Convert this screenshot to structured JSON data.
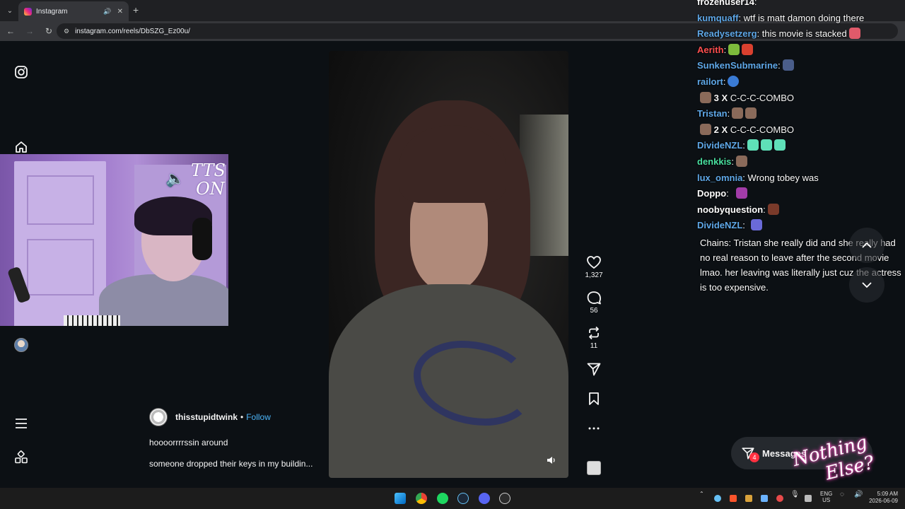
{
  "browser": {
    "tab_title": "Instagram",
    "new_tab": "+",
    "close": "✕",
    "url": "instagram.com/reels/DbSZG_Ez00u/"
  },
  "overlay": {
    "tts_line1": "TTS",
    "tts_line2": "ON"
  },
  "post": {
    "username": "thisstupidtwink",
    "separator": "•",
    "follow": "Follow",
    "caption_line1": "hoooorrrrssin around",
    "caption_line2": "someone dropped their keys in my buildin..."
  },
  "actions": {
    "likes": "1,327",
    "comments": "56",
    "reposts": "11"
  },
  "chat": {
    "messages": [
      {
        "user": "frozenuser14",
        "text": "",
        "color": "#ffffff"
      },
      {
        "user": "kumquaff",
        "text": "wtf is matt damon doing there",
        "color": "#5fa8e8"
      },
      {
        "user": "Readysetzerg",
        "text": "this movie is stacked",
        "color": "#5fa8e8"
      },
      {
        "user": "Aerith",
        "text": "",
        "color": "#ff4f4f"
      },
      {
        "user": "SunkenSubmarine",
        "text": "",
        "color": "#5fa8e8"
      },
      {
        "user": "railort",
        "text": "",
        "color": "#5fa8e8"
      }
    ],
    "combo1": {
      "count": "3",
      "x": "X",
      "label": "C-C-C-COMBO"
    },
    "tristan": {
      "user": "Tristan",
      "color": "#5fa8e8"
    },
    "combo2": {
      "count": "2",
      "x": "X",
      "label": "C-C-C-COMBO"
    },
    "messages2": [
      {
        "user": "DivideNZL",
        "text": "",
        "color": "#5fa8e8"
      },
      {
        "user": "denkkis",
        "text": "",
        "color": "#49e0a0"
      },
      {
        "user": "lux_omnia",
        "text": "Wrong tobey was",
        "color": "#5fa8e8"
      },
      {
        "user": "Doppo",
        "text": "",
        "color": "#ffffff"
      },
      {
        "user": "noobyquestion",
        "text": "",
        "color": "#ffffff"
      },
      {
        "user": "DivideNZL",
        "text": "",
        "color": "#5fa8e8"
      }
    ],
    "long_message": "Chains: Tristan she really did and she really had no real reason to leave after the second movie lmao. her leaving was literally just cuz the actress is too expensive."
  },
  "messages_button": {
    "label": "Messages",
    "badge": "4"
  },
  "watermark": {
    "line1": "Nothing",
    "line2": "Else?"
  },
  "taskbar": {
    "lang1": "ENG",
    "lang2": "US",
    "time": "5:09 AM",
    "date": "2026-06-09"
  }
}
